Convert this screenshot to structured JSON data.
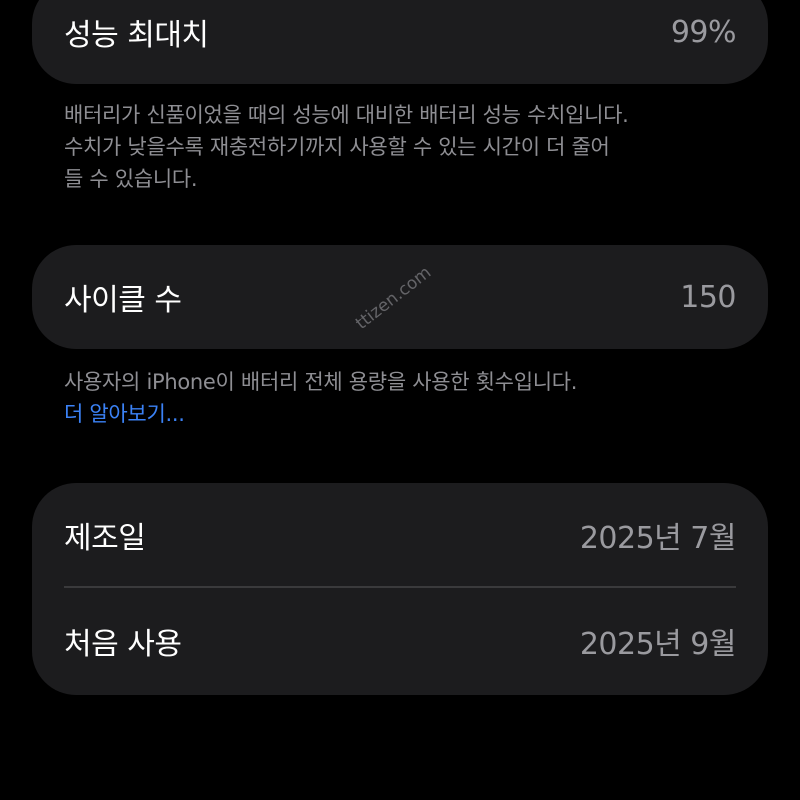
{
  "performance": {
    "label": "성능 최대치",
    "value": "99%",
    "description_lines": [
      "배터리가 신품이었을 때의 성능에 대비한 배터리 성능 수치입니다.",
      "수치가 낮을수록 재충전하기까지 사용할 수 있는 시간이 더 줄어",
      "들 수 있습니다."
    ]
  },
  "cycle": {
    "label": "사이클 수",
    "value": "150",
    "description": "사용자의 iPhone이 배터리 전체 용량을 사용한 횟수입니다.",
    "learn_more": "더 알아보기..."
  },
  "dates": {
    "manufacture": {
      "label": "제조일",
      "value": "2025년 7월"
    },
    "first_use": {
      "label": "처음 사용",
      "value": "2025년 9월"
    }
  },
  "watermark": "ttizen.com",
  "colors": {
    "background": "#000000",
    "card": "#1c1c1e",
    "secondary_text": "#8e8e93",
    "link": "#3b82f6"
  }
}
